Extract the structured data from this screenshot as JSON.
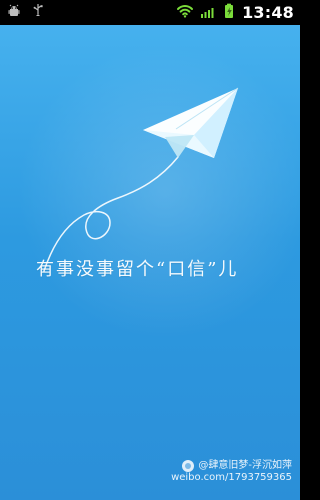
{
  "status_bar": {
    "time": "13:48",
    "icons": [
      "android-icon",
      "usb-icon",
      "wifi-icon",
      "signal-icon",
      "battery-charging-icon"
    ]
  },
  "splash": {
    "tagline": "有事没事留个“口信”儿"
  },
  "watermark": {
    "line1": "@肆意旧梦-浮沉如萍",
    "line2": "weibo.com/1793759365"
  },
  "colors": {
    "status_bar_bg": "#000000",
    "sky_top": "#46b1ee",
    "sky_bottom": "#2b8fd8",
    "plane": "#ffffff",
    "plane_shadow": "#bfe7f6"
  }
}
